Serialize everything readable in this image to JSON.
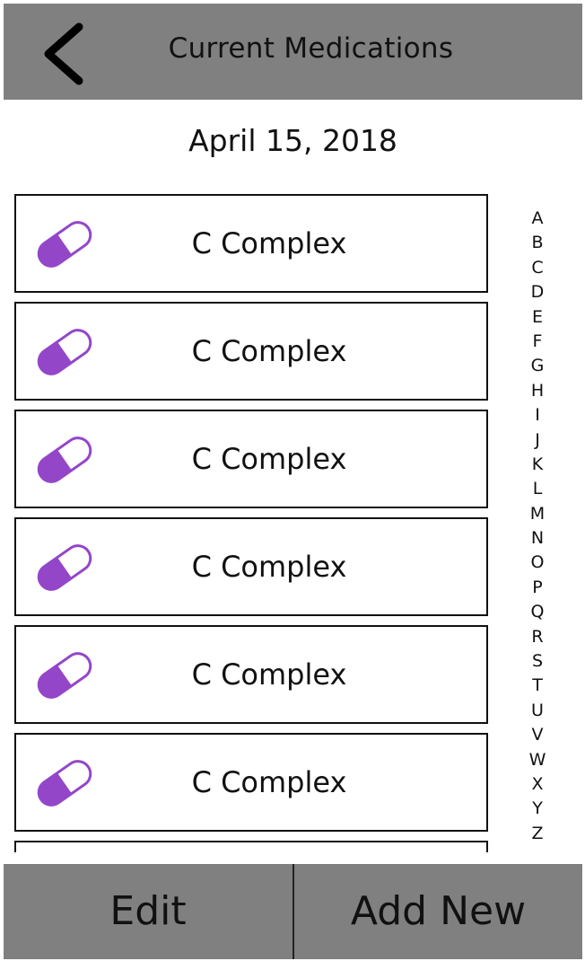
{
  "header": {
    "title": "Current Medications",
    "back_icon": "chevron-left-icon"
  },
  "date": "April 15, 2018",
  "medications": [
    {
      "name": "C Complex",
      "icon": "pill-capsule-icon"
    },
    {
      "name": "C Complex",
      "icon": "pill-capsule-icon"
    },
    {
      "name": "C Complex",
      "icon": "pill-capsule-icon"
    },
    {
      "name": "C Complex",
      "icon": "pill-capsule-icon"
    },
    {
      "name": "C Complex",
      "icon": "pill-capsule-icon"
    },
    {
      "name": "C Complex",
      "icon": "pill-capsule-icon"
    },
    {
      "name": "",
      "icon": ""
    }
  ],
  "alphabet": [
    "A",
    "B",
    "C",
    "D",
    "E",
    "F",
    "G",
    "H",
    "I",
    "J",
    "K",
    "L",
    "M",
    "N",
    "O",
    "P",
    "Q",
    "R",
    "S",
    "T",
    "U",
    "V",
    "W",
    "X",
    "Y",
    "Z"
  ],
  "footer": {
    "edit_label": "Edit",
    "add_label": "Add New"
  },
  "colors": {
    "header_bg": "#808080",
    "footer_bg": "#808080",
    "pill_accent": "#9446C9"
  }
}
